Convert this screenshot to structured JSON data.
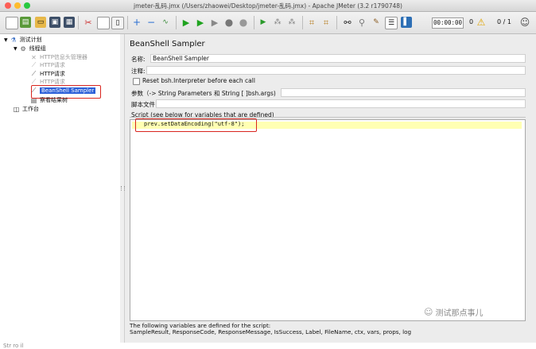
{
  "window": {
    "title": "jmeter-乱码.jmx (/Users/zhaowei/Desktop/jmeter-乱码.jmx) - Apache JMeter (3.2 r1790748)"
  },
  "toolbar": {
    "timer": "00:00:00",
    "error_count": "0",
    "threads": "0 / 1"
  },
  "tree": {
    "root": "测试计划",
    "thread_group": "线程组",
    "items": [
      {
        "label": "HTTP信息头管理器",
        "disabled": true
      },
      {
        "label": "HTTP请求",
        "disabled": true
      },
      {
        "label": "HTTP请求",
        "disabled": false
      },
      {
        "label": "HTTP请求",
        "disabled": true
      },
      {
        "label": "BeanShell Sampler",
        "selected": true
      },
      {
        "label": "察看结果树",
        "disabled": false
      }
    ],
    "workbench": "工作台"
  },
  "panel": {
    "heading": "BeanShell Sampler",
    "name_label": "名称:",
    "name_value": "BeanShell Sampler",
    "comment_label": "注释:",
    "comment_value": "",
    "reset_label": "Reset bsh.Interpreter before each call",
    "params_label": "参数（-> String Parameters 和 String [ ]bsh.args)",
    "params_value": "",
    "script_file_label": "脚本文件",
    "script_file_value": "",
    "script_label": "Script (see below for variables that are defined)",
    "script_code": "prev.setDataEncoding(\"utf-8\");",
    "footer_line1": "The following variables are defined for the script:",
    "footer_line2": "SampleResult, ResponseCode, ResponseMessage, IsSuccess, Label, FileName, ctx, vars, props, log"
  },
  "watermark": "测试那点事儿",
  "bottom_text": "Str  ro  il"
}
